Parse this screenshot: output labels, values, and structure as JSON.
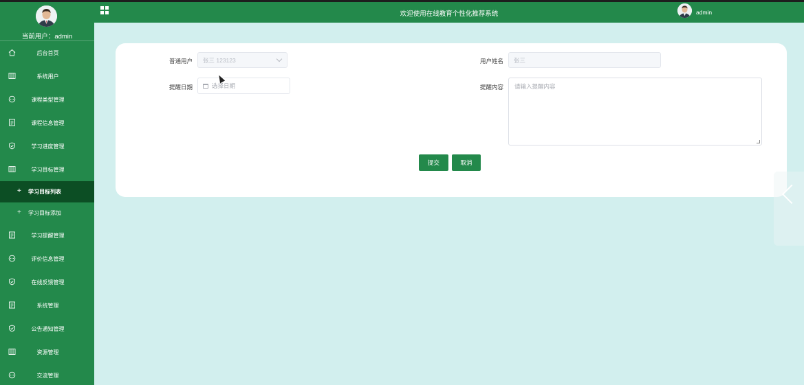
{
  "sidebar": {
    "user_label": "当前用户：",
    "user_name": "admin",
    "menu_top": [
      {
        "label": "后台首页",
        "icon": "home-icon"
      },
      {
        "label": "系统用户",
        "icon": "columns-icon"
      },
      {
        "label": "课程类型管理",
        "icon": "chat-icon"
      },
      {
        "label": "课程信息管理",
        "icon": "document-icon"
      },
      {
        "label": "学习进度管理",
        "icon": "shield-icon"
      },
      {
        "label": "学习目标管理",
        "icon": "columns-icon"
      }
    ],
    "submenu": [
      {
        "label": "学习目标列表",
        "active": true
      },
      {
        "label": "学习目标添加",
        "active": false
      }
    ],
    "menu_bottom": [
      {
        "label": "学习提醒管理",
        "icon": "document-icon"
      },
      {
        "label": "评价信息管理",
        "icon": "chat-icon"
      },
      {
        "label": "在线反馈管理",
        "icon": "shield-icon"
      },
      {
        "label": "系统管理",
        "icon": "document-icon"
      },
      {
        "label": "公告通知管理",
        "icon": "shield-icon"
      },
      {
        "label": "资源管理",
        "icon": "columns-icon"
      },
      {
        "label": "交流管理",
        "icon": "chat-icon"
      }
    ]
  },
  "topbar": {
    "title": "欢迎使用在线教育个性化推荐系统",
    "user": "admin"
  },
  "form": {
    "user_label": "普通用户",
    "user_value": "张三 123123",
    "name_label": "用户姓名",
    "name_value": "张三",
    "date_label": "提醒日期",
    "date_placeholder": "选择日期",
    "content_label": "提醒内容",
    "content_placeholder": "请输入提醒内容",
    "submit_label": "提交",
    "cancel_label": "取消"
  },
  "colors": {
    "primary": "#23894b",
    "active_menu": "#0c4e24",
    "background": "#d2efee"
  }
}
